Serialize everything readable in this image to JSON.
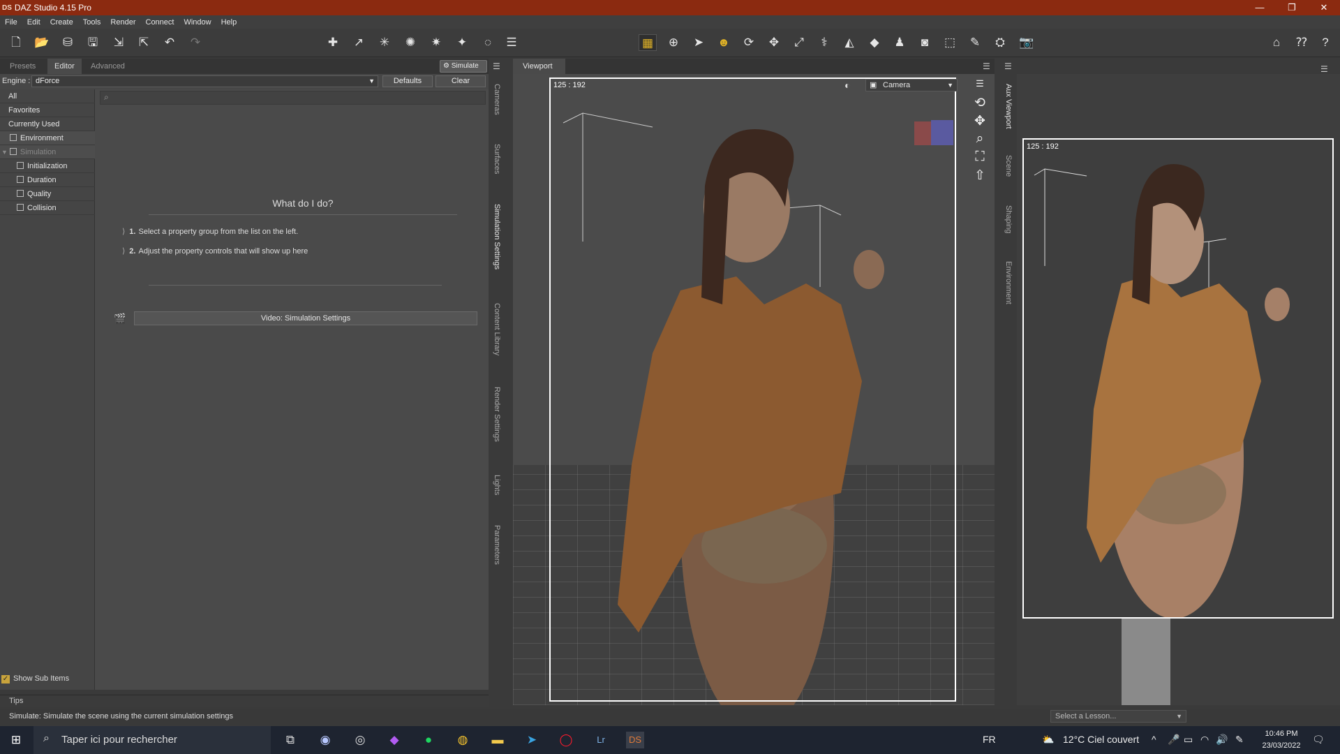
{
  "window": {
    "icon": "DS",
    "title": "DAZ Studio 4.15 Pro",
    "controls": [
      "—",
      "❐",
      "✕"
    ]
  },
  "menu": [
    "File",
    "Edit",
    "Create",
    "Tools",
    "Render",
    "Connect",
    "Window",
    "Help"
  ],
  "left_tabs": {
    "presets": "Presets",
    "editor": "Editor",
    "advanced": "Advanced",
    "simulate_button": "Simulate"
  },
  "engine": {
    "label": "Engine :",
    "value": "dForce",
    "defaults": "Defaults",
    "clear": "Clear"
  },
  "property_list": {
    "top": [
      "All",
      "Favorites",
      "Currently Used"
    ],
    "environment": "Environment",
    "simulation": "Simulation",
    "children": [
      "Initialization",
      "Duration",
      "Quality",
      "Collision"
    ],
    "show_sub_items": "Show Sub Items"
  },
  "help": {
    "heading": "What do I do?",
    "step1_num": "1.",
    "step1": "Select a property group from the list on the left.",
    "step2_num": "2.",
    "step2": "Adjust the property controls that will show up here",
    "video_button": "Video: Simulation Settings"
  },
  "side_tabs_left": [
    "Cameras",
    "Surfaces",
    "Simulation Settings",
    "Content Library",
    "Render Settings",
    "Lights",
    "Parameters"
  ],
  "side_tabs_right": [
    "Aux Viewport",
    "Scene",
    "Shaping",
    "Environment"
  ],
  "viewport": {
    "tab": "Viewport",
    "coords": "125 : 192",
    "camera": "Camera"
  },
  "aux_viewport": {
    "coords": "125 : 192"
  },
  "tips_label": "Tips",
  "status_text": "Simulate: Simulate the scene using the current simulation settings",
  "lesson_placeholder": "Select a Lesson...",
  "taskbar": {
    "search_placeholder": "Taper ici pour rechercher",
    "lang": "FR",
    "weather": "12°C  Ciel couvert",
    "time": "10:46 PM",
    "date": "23/03/2022"
  }
}
